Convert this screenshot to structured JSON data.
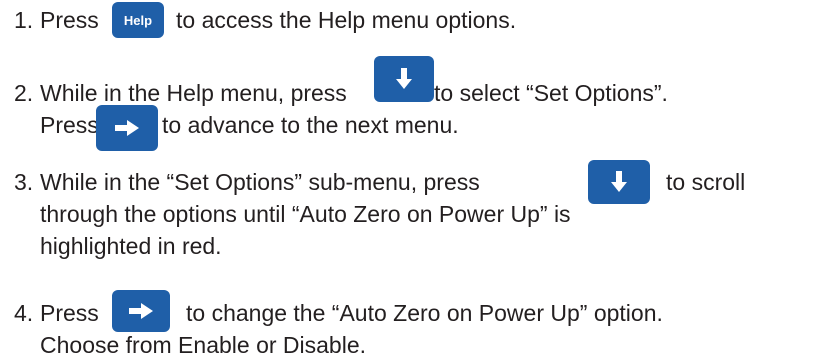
{
  "steps": [
    {
      "number": "1.",
      "segments": [
        "Press",
        "to access the Help menu options."
      ],
      "key_label": "Help",
      "key_icon": "help-key"
    },
    {
      "number": "2.",
      "line1": [
        "While in the Help menu, press",
        "to select “Set Options”."
      ],
      "line2": [
        "Press",
        "to advance to the next menu."
      ],
      "key_icons": [
        "down-arrow-icon",
        "right-arrow-icon"
      ]
    },
    {
      "number": "3.",
      "line1": [
        "While in the “Set Options” sub-menu, press",
        "to scroll"
      ],
      "line2": "through the options until “Auto Zero on Power Up” is",
      "line3": "highlighted in red.",
      "key_icon": "down-arrow-icon"
    },
    {
      "number": "4.",
      "line1": [
        "Press",
        "to change the “Auto Zero on Power Up” option."
      ],
      "line2": "Choose from Enable or Disable.",
      "key_icon": "right-arrow-icon"
    }
  ],
  "colors": {
    "key_background": "#1f5fa8",
    "key_foreground": "#ffffff",
    "text": "#231f20"
  }
}
